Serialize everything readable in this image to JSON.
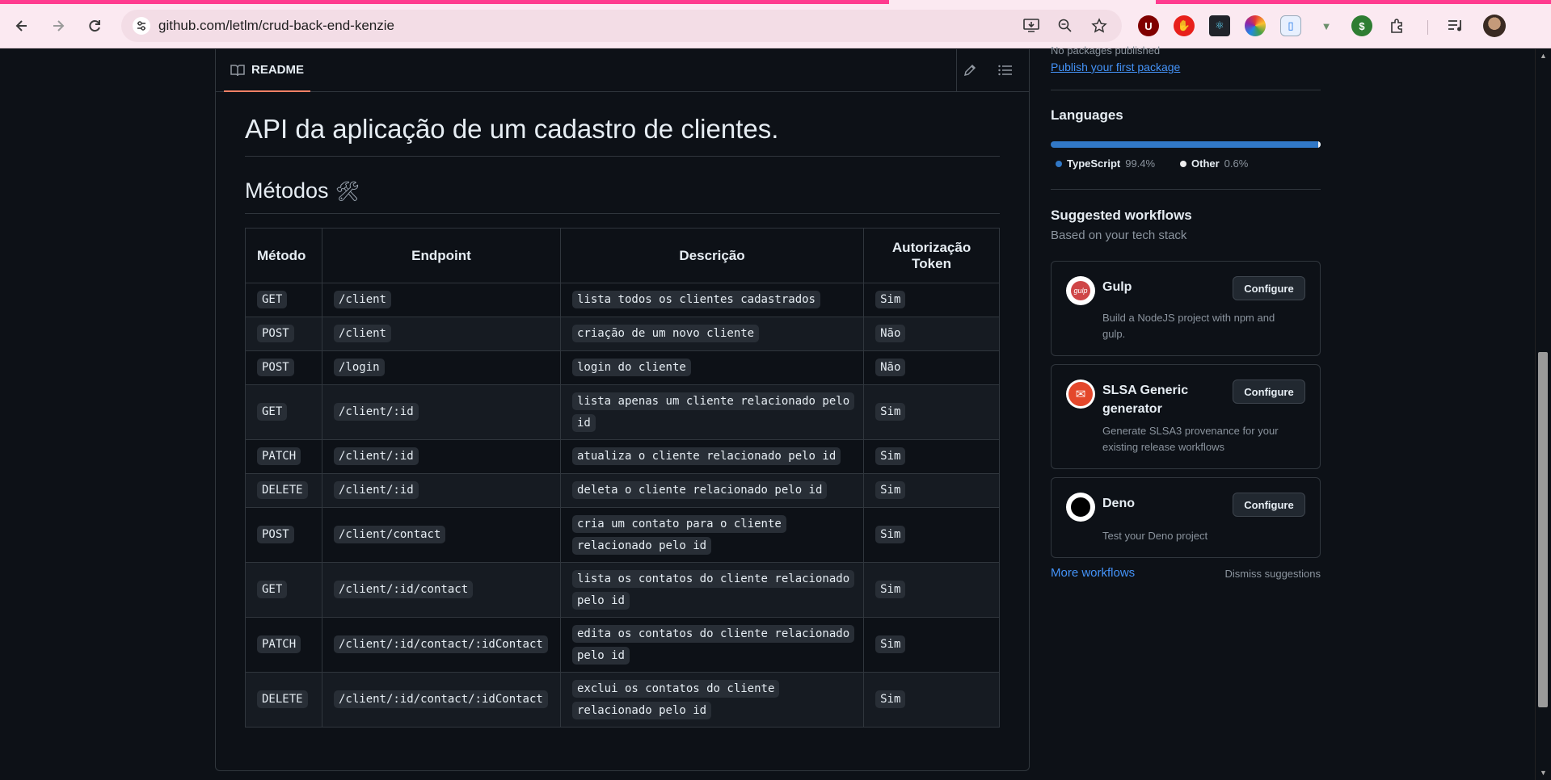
{
  "browser": {
    "url": "github.com/letlm/crud-back-end-kenzie",
    "extensions": [
      "ublock-icon",
      "adblock-icon",
      "react-devtools-icon",
      "color-picker-icon",
      "clipboard-icon",
      "vue-icon",
      "dollar-icon",
      "extensions-icon"
    ]
  },
  "readme": {
    "tab_label": "README",
    "title": "API da aplicação de um cadastro de clientes.",
    "methods_heading": "Métodos",
    "methods_emoji": "🛠",
    "table": {
      "headers": [
        "Método",
        "Endpoint",
        "Descrição",
        "Autorização Token"
      ],
      "rows": [
        {
          "method": "GET",
          "endpoint": "/client",
          "desc": "lista todos os clientes cadastrados",
          "auth": "Sim"
        },
        {
          "method": "POST",
          "endpoint": "/client",
          "desc": "criação de um novo cliente",
          "auth": "Não"
        },
        {
          "method": "POST",
          "endpoint": "/login",
          "desc": "login do cliente",
          "auth": "Não"
        },
        {
          "method": "GET",
          "endpoint": "/client/:id",
          "desc": "lista apenas um cliente relacionado pelo id",
          "auth": "Sim"
        },
        {
          "method": "PATCH",
          "endpoint": "/client/:id",
          "desc": "atualiza o cliente relacionado pelo id",
          "auth": "Sim"
        },
        {
          "method": "DELETE",
          "endpoint": "/client/:id",
          "desc": "deleta o cliente relacionado pelo id",
          "auth": "Sim"
        },
        {
          "method": "POST",
          "endpoint": "/client/contact",
          "desc": "cria um contato para o cliente relacionado pelo id",
          "auth": "Sim"
        },
        {
          "method": "GET",
          "endpoint": "/client/:id/contact",
          "desc": "lista os contatos do cliente relacionado pelo id",
          "auth": "Sim"
        },
        {
          "method": "PATCH",
          "endpoint": "/client/:id/contact/:idContact",
          "desc": "edita os contatos do cliente relacionado pelo id",
          "auth": "Sim"
        },
        {
          "method": "DELETE",
          "endpoint": "/client/:id/contact/:idContact",
          "desc": "exclui os contatos do cliente relacionado pelo id",
          "auth": "Sim"
        }
      ]
    }
  },
  "sidebar": {
    "no_packages": "No packages published",
    "publish_link": "Publish your first package",
    "languages_heading": "Languages",
    "languages": [
      {
        "name": "TypeScript",
        "pct": "99.4%",
        "color": "#3178c6"
      },
      {
        "name": "Other",
        "pct": "0.6%",
        "color": "#ededed"
      }
    ],
    "workflows_heading": "Suggested workflows",
    "workflows_sub": "Based on your tech stack",
    "workflows": [
      {
        "name": "Gulp",
        "desc": "Build a NodeJS project with npm and gulp.",
        "button": "Configure",
        "icon": "gulp-icon"
      },
      {
        "name": "SLSA Generic generator",
        "desc": "Generate SLSA3 provenance for your existing release workflows",
        "button": "Configure",
        "icon": "slsa-icon"
      },
      {
        "name": "Deno",
        "desc": "Test your Deno project",
        "button": "Configure",
        "icon": "deno-icon"
      }
    ],
    "more_workflows": "More workflows",
    "dismiss": "Dismiss suggestions"
  }
}
